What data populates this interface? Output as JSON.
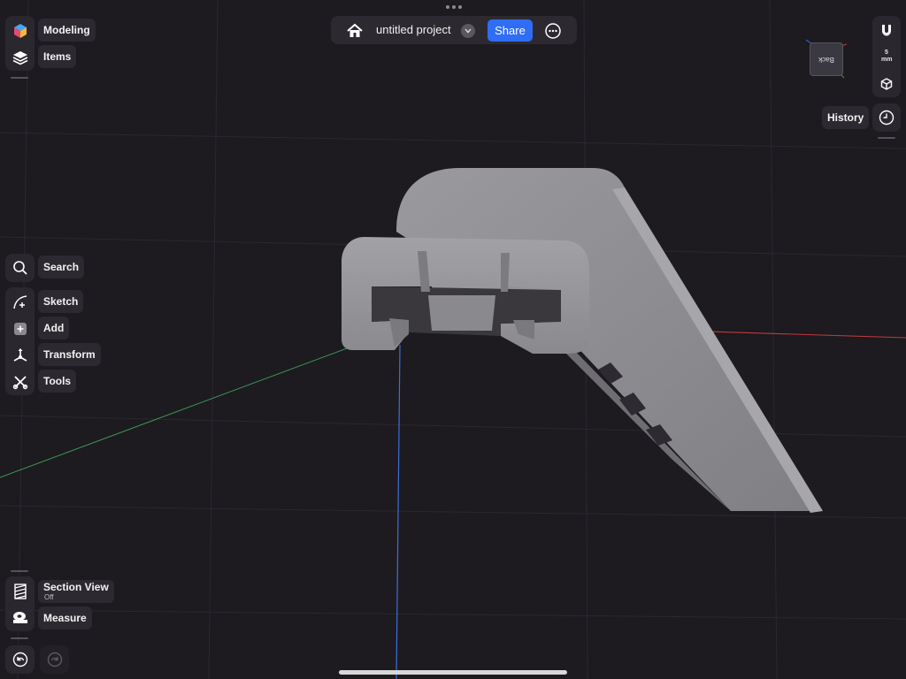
{
  "topbar": {
    "project_name": "untitled project",
    "share_label": "Share"
  },
  "left_top": {
    "modeling_label": "Modeling",
    "items_label": "Items"
  },
  "left_middle": {
    "search_label": "Search",
    "sketch_label": "Sketch",
    "add_label": "Add",
    "transform_label": "Transform",
    "tools_label": "Tools"
  },
  "left_bottom": {
    "section_view_label": "Section View",
    "section_view_state": "Off",
    "measure_label": "Measure"
  },
  "right": {
    "history_label": "History",
    "view_cube_face": "Back",
    "unit_value": "5",
    "unit": "mm"
  },
  "colors": {
    "accent": "#2f6df6",
    "x_axis": "#c23a3a",
    "y_axis": "#3a9b55",
    "z_axis": "#3f6fd9",
    "model": "#8e8e92",
    "background": "#1d1a20"
  }
}
